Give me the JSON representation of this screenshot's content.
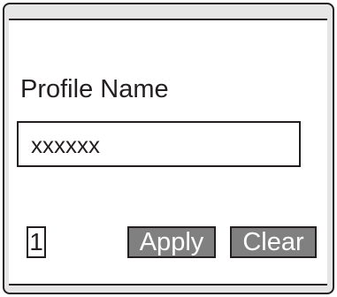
{
  "screen": {
    "title": "Profile Name",
    "name_field_value": "xxxxxx",
    "page_number": "1"
  },
  "buttons": {
    "apply_label": "Apply",
    "clear_label": "Clear"
  },
  "colors": {
    "button_fill": "#808080",
    "button_text": "#ffffff",
    "bezel": "#e6e6e7",
    "outline": "#231f20"
  }
}
